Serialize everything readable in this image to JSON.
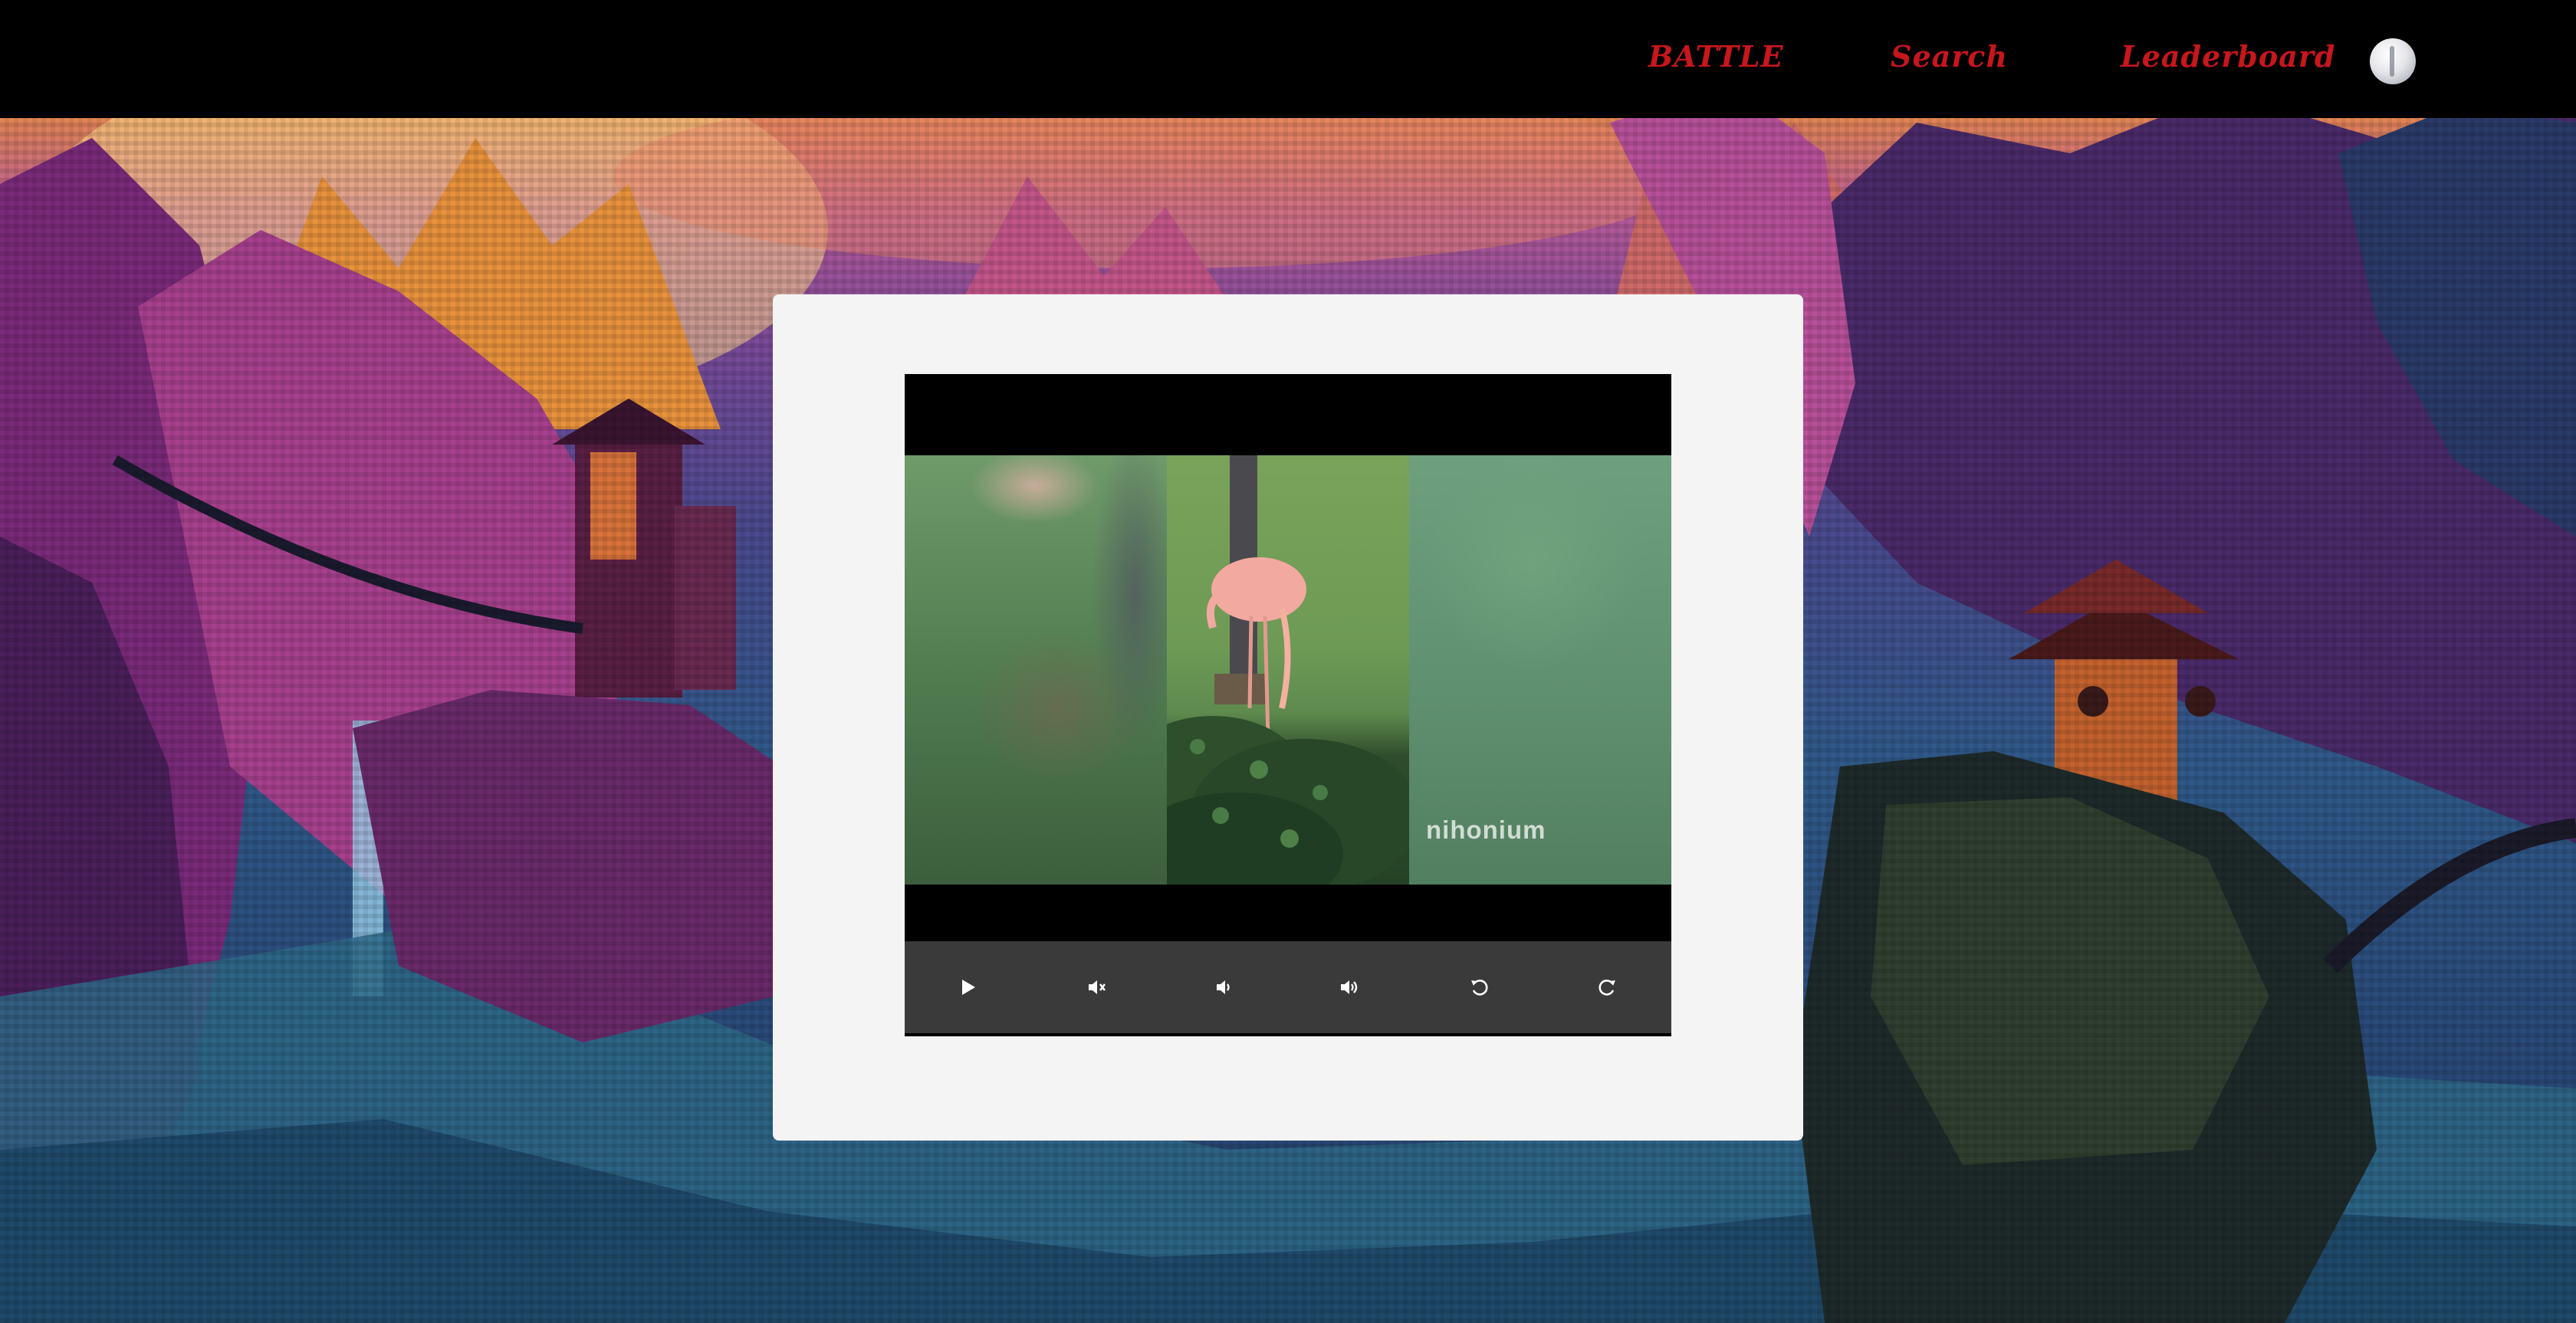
{
  "nav": {
    "battle_label": "BATTLE",
    "search_label": "Search",
    "leaderboard_label": "Leaderboard",
    "accent_color": "#c8161d"
  },
  "user": {
    "avatar_icon": "moon-avatar-icon"
  },
  "player": {
    "watermark": "nihonium",
    "controls": [
      {
        "icon": "play-icon"
      },
      {
        "icon": "mute-icon"
      },
      {
        "icon": "volume-down-icon"
      },
      {
        "icon": "volume-up-icon"
      },
      {
        "icon": "rewind-icon"
      },
      {
        "icon": "forward-icon"
      }
    ]
  }
}
